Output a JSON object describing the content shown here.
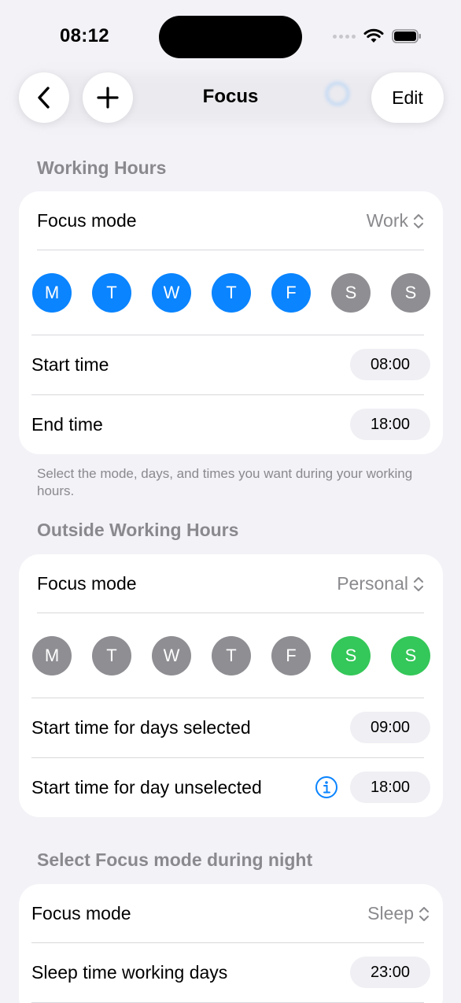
{
  "status_bar": {
    "time": "08:12"
  },
  "nav": {
    "title": "Focus",
    "edit_label": "Edit"
  },
  "working_hours": {
    "header": "Working Hours",
    "focus_label": "Focus mode",
    "focus_value": "Work",
    "days": [
      {
        "letter": "M",
        "selected": true
      },
      {
        "letter": "T",
        "selected": true
      },
      {
        "letter": "W",
        "selected": true
      },
      {
        "letter": "T",
        "selected": true
      },
      {
        "letter": "F",
        "selected": true
      },
      {
        "letter": "S",
        "selected": false
      },
      {
        "letter": "S",
        "selected": false
      }
    ],
    "start_label": "Start time",
    "start_value": "08:00",
    "end_label": "End time",
    "end_value": "18:00",
    "footnote": "Select the mode, days, and times you want during your working hours."
  },
  "outside_hours": {
    "header": "Outside Working Hours",
    "focus_label": "Focus mode",
    "focus_value": "Personal",
    "days": [
      {
        "letter": "M",
        "selected": false
      },
      {
        "letter": "T",
        "selected": false
      },
      {
        "letter": "W",
        "selected": false
      },
      {
        "letter": "T",
        "selected": false
      },
      {
        "letter": "F",
        "selected": false
      },
      {
        "letter": "S",
        "selected": true
      },
      {
        "letter": "S",
        "selected": true
      }
    ],
    "start_selected_label": "Start time for days selected",
    "start_selected_value": "09:00",
    "start_unselected_label": "Start time for day unselected",
    "start_unselected_value": "18:00"
  },
  "night": {
    "header": "Select Focus mode during night",
    "focus_label": "Focus mode",
    "focus_value": "Sleep",
    "sleep_label": "Sleep time working days",
    "sleep_value": "23:00"
  },
  "colors": {
    "blue": "#0a84ff",
    "green": "#34c759",
    "gray_day": "#8e8e93",
    "info": "#0a84ff"
  }
}
